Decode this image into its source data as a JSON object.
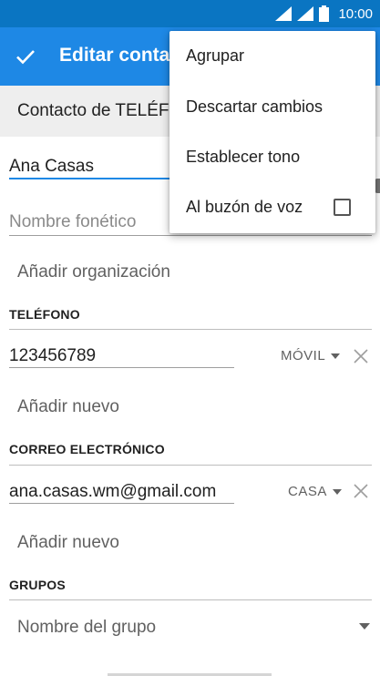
{
  "status_bar": {
    "time": "10:00",
    "icons": [
      "signal-icon",
      "signal-icon",
      "battery-icon"
    ]
  },
  "app_bar": {
    "title": "Editar contacto",
    "save_icon": "check-icon"
  },
  "account": {
    "label": "Contacto de TELÉFONO"
  },
  "name": {
    "value": "Ana Casas",
    "phonetic_placeholder": "Nombre fonético"
  },
  "organization": {
    "label": "Añadir organización"
  },
  "phone_section": {
    "header": "TELÉFONO",
    "number": "123456789",
    "type": "MÓVIL",
    "add_new": "Añadir nuevo"
  },
  "email_section": {
    "header": "CORREO ELECTRÓNICO",
    "address": "ana.casas.wm@gmail.com",
    "type": "CASA",
    "add_new": "Añadir nuevo"
  },
  "groups_section": {
    "header": "GRUPOS",
    "placeholder": "Nombre del grupo"
  },
  "menu": {
    "items": [
      {
        "label": "Agrupar"
      },
      {
        "label": "Descartar cambios"
      },
      {
        "label": "Establecer tono"
      },
      {
        "label": "Al buzón de voz",
        "checked": false
      }
    ]
  },
  "colors": {
    "status_bar": "#0a75c2",
    "app_bar": "#1e88e5",
    "accent": "#1e88e5"
  }
}
